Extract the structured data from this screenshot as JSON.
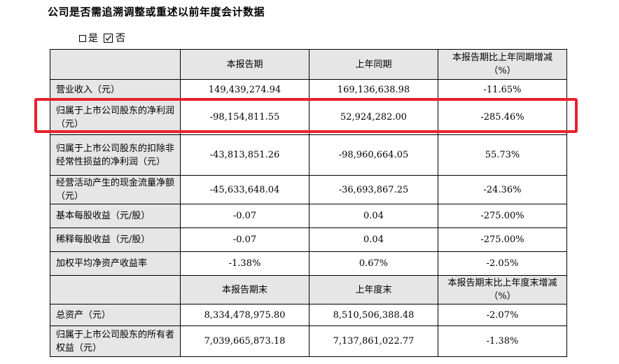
{
  "section_title": "公司是否需追溯调整或重述以前年度会计数据",
  "choice": {
    "yes_label": "是",
    "no_label": "否",
    "selected": "否"
  },
  "table1": {
    "headers": [
      "",
      "本报告期",
      "上年同期",
      "本报告期比上年同期增减（%）"
    ],
    "rows": [
      {
        "label": "营业收入（元）",
        "cur": "149,439,274.94",
        "prev": "169,136,638.98",
        "chg": "-11.65%"
      },
      {
        "label": "归属于上市公司股东的净利润（元）",
        "cur": "-98,154,811.55",
        "prev": "52,924,282.00",
        "chg": "-285.46%"
      },
      {
        "label": "归属于上市公司股东的扣除非经常性损益的净利润（元）",
        "cur": "-43,813,851.26",
        "prev": "-98,960,664.05",
        "chg": "55.73%"
      },
      {
        "label": "经营活动产生的现金流量净额（元）",
        "cur": "-45,633,648.04",
        "prev": "-36,693,867.25",
        "chg": "-24.36%"
      },
      {
        "label": "基本每股收益（元/股）",
        "cur": "-0.07",
        "prev": "0.04",
        "chg": "-275.00%"
      },
      {
        "label": "稀释每股收益（元/股）",
        "cur": "-0.07",
        "prev": "0.04",
        "chg": "-275.00%"
      },
      {
        "label": "加权平均净资产收益率",
        "cur": "-1.38%",
        "prev": "0.67%",
        "chg": "-2.05%"
      }
    ]
  },
  "table2": {
    "headers": [
      "",
      "本报告期末",
      "上年度末",
      "本报告期末比上年度末增减（%）"
    ],
    "rows": [
      {
        "label": "总资产（元）",
        "cur": "8,334,478,975.80",
        "prev": "8,510,506,388.48",
        "chg": "-2.07%"
      },
      {
        "label": "归属于上市公司股东的所有者权益（元）",
        "cur": "7,039,665,873.18",
        "prev": "7,137,861,022.77",
        "chg": "-1.38%"
      }
    ]
  },
  "colors": {
    "header_bg": "#e7e6e6",
    "highlight": "#e8212e"
  }
}
